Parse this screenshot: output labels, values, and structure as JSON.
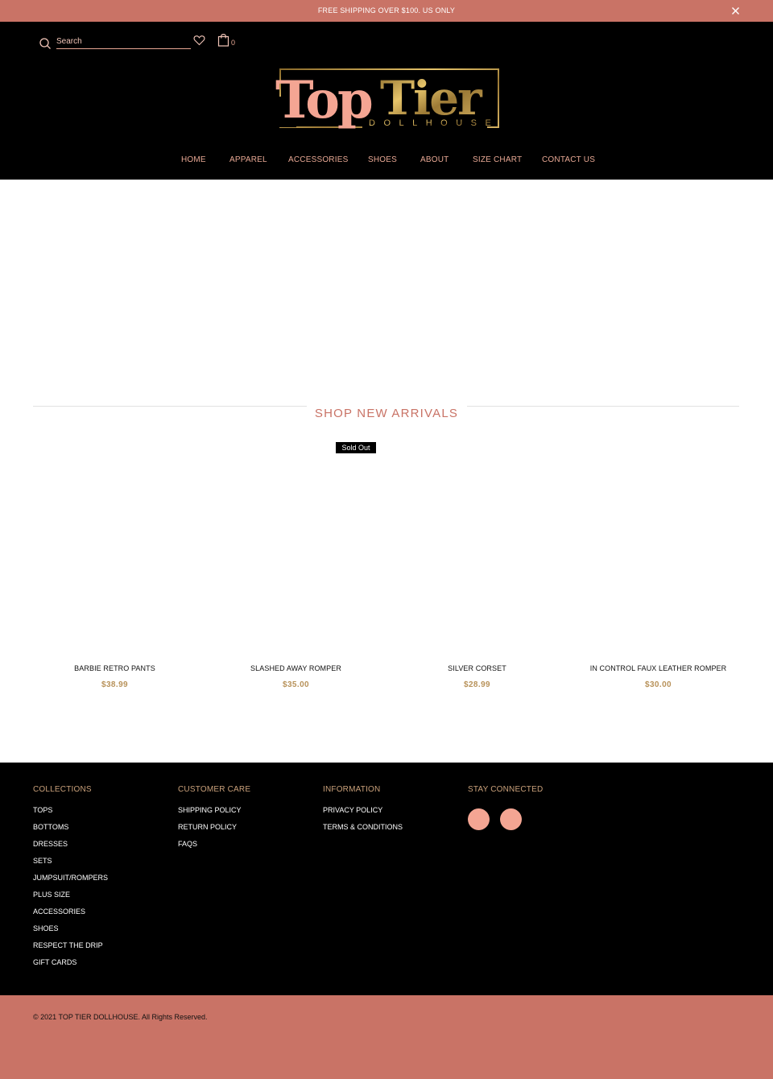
{
  "announcement": {
    "text": "FREE SHIPPING OVER $100. US ONLY",
    "close_icon": "close-icon"
  },
  "header": {
    "search_placeholder": "Search",
    "wishlist_icon": "heart-icon",
    "cart_icon": "shopping-bag-icon",
    "cart_count": "0",
    "logo": {
      "word1": "Top",
      "word2": "Tier",
      "sub": "DOLLHOUSE"
    }
  },
  "nav": {
    "items": [
      {
        "label": "HOME"
      },
      {
        "label": "APPAREL"
      },
      {
        "label": "ACCESSORIES"
      },
      {
        "label": "SHOES"
      },
      {
        "label": "ABOUT"
      },
      {
        "label": "SIZE CHART"
      },
      {
        "label": "CONTACT US"
      }
    ]
  },
  "new_arrivals": {
    "title": "SHOP NEW ARRIVALS",
    "sold_out_label": "Sold Out",
    "products": [
      {
        "name": "BARBIE RETRO PANTS",
        "price": "$38.99"
      },
      {
        "name": "SLASHED AWAY ROMPER",
        "price": "$35.00"
      },
      {
        "name": "SILVER CORSET",
        "price": "$28.99"
      },
      {
        "name": "IN CONTROL FAUX LEATHER ROMPER",
        "price": "$30.00"
      }
    ]
  },
  "footer": {
    "collections": {
      "heading": "COLLECTIONS",
      "links": [
        "TOPS",
        "BOTTOMS",
        "DRESSES",
        "SETS",
        "JUMPSUIT/ROMPERS",
        "PLUS SIZE",
        "ACCESSORIES",
        "SHOES",
        "RESPECT THE DRIP",
        "GIFT CARDS"
      ]
    },
    "customer_care": {
      "heading": "CUSTOMER CARE",
      "links": [
        "SHIPPING POLICY",
        "RETURN POLICY",
        "FAQS"
      ]
    },
    "information": {
      "heading": "INFORMATION",
      "links": [
        "PRIVACY POLICY",
        "TERMS & CONDITIONS"
      ]
    },
    "stay_connected": {
      "heading": "STAY CONNECTED",
      "social_icons": [
        "social-icon",
        "social-icon"
      ]
    }
  },
  "copyright": "© 2021 TOP TIER DOLLHOUSE. All Rights Reserved.",
  "colors": {
    "accent": "#c97366",
    "gold": "#b8925a",
    "nav_text": "#e8a894",
    "header_bg": "#000000"
  }
}
